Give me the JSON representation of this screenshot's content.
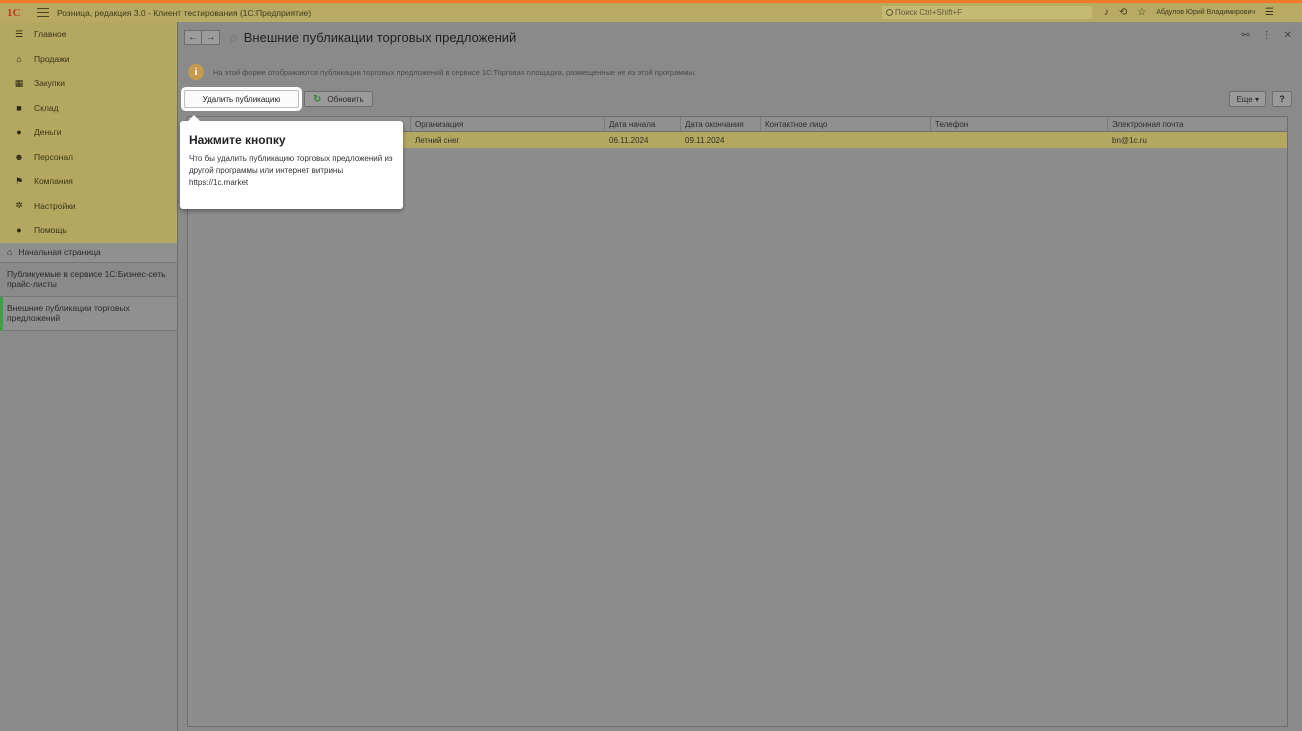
{
  "titlebar": {
    "logo": "1С",
    "title": "Розница, редакция 3.0 - Клиент тестирования (1С:Предприятие)",
    "search_placeholder": "Поиск Ctrl+Shift+F",
    "user": "Абдулов Юрий Владимирович"
  },
  "sections": [
    {
      "label": "Главное",
      "icon": "menu-icon"
    },
    {
      "label": "Продажи",
      "icon": "sales-icon"
    },
    {
      "label": "Закупки",
      "icon": "purchases-icon"
    },
    {
      "label": "Склад",
      "icon": "warehouse-icon"
    },
    {
      "label": "Деньги",
      "icon": "money-icon"
    },
    {
      "label": "Персонал",
      "icon": "personnel-icon"
    },
    {
      "label": "Компания",
      "icon": "company-icon"
    },
    {
      "label": "Настройки",
      "icon": "settings-icon"
    },
    {
      "label": "Помощь",
      "icon": "help-icon"
    }
  ],
  "nav": {
    "home": "Начальная страница",
    "pages": [
      "Публикуемые в сервисе 1С:Бизнес-сеть прайс-листы",
      "Внешние публикации торговых предложений"
    ]
  },
  "form": {
    "title": "Внешние публикации торговых предложений",
    "info": "На этой форме отображаются публикации торговых предложений в сервисе 1С:Торговая площадка, размещенные не из этой программы.",
    "delete_button": "Удалить публикацию",
    "refresh_button": "Обновить",
    "more_button": "Еще",
    "help_button": "?"
  },
  "table": {
    "columns": [
      "",
      "Организация",
      "Дата начала",
      "Дата окончания",
      "Контактное лицо",
      "Телефон",
      "Электронная почта"
    ],
    "rows": [
      [
        "",
        "Летний снег",
        "06.11.2024",
        "09.11.2024",
        "",
        "",
        "bn@1c.ru"
      ]
    ]
  },
  "tooltip": {
    "title": "Нажмите кнопку",
    "body": "Что бы удалить публикацию торговых предложений из другой программы или интернет витрины https://1c.market"
  }
}
